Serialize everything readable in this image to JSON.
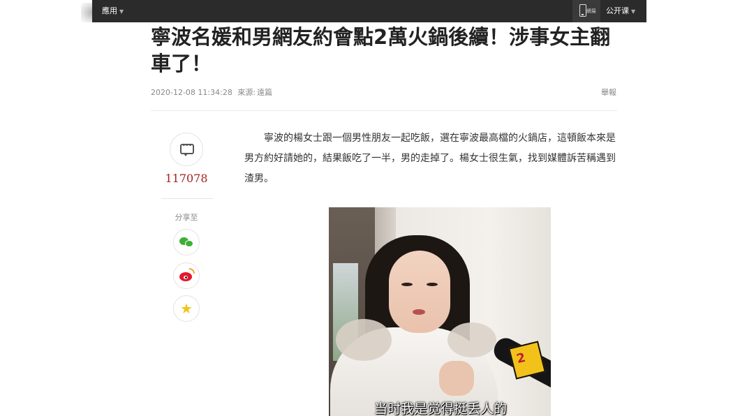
{
  "topbar": {
    "apps_label": "應用",
    "phone_label": "網易",
    "open_course_label": "公开课"
  },
  "article": {
    "title": "寧波名媛和男網友約會點2萬火鍋後續！涉事女主翻車了！",
    "datetime": "2020-12-08 11:34:28",
    "source_prefix": "來源:",
    "source": "遠篇",
    "report_label": "舉報",
    "paragraph": "寧波的楊女士跟一個男性朋友一起吃飯，選在寧波最高檔的火鍋店，這頓飯本來是男方約好請她的，結果飯吃了一半，男的走掉了。楊女士很生氣，找到媒體訴苦稱遇到渣男。",
    "image": {
      "subtitle": "当时我是觉得挺丢人的"
    }
  },
  "sidebar": {
    "comment_icon": "comment-icon",
    "comment_count": "117078",
    "share_label": "分享至",
    "share_icons": [
      "wechat-icon",
      "weibo-icon",
      "favorite-icon"
    ]
  },
  "colors": {
    "topbar_bg": "#2b2b2b",
    "count_red": "#a52020",
    "wechat_green": "#3cb034",
    "weibo_red": "#e6162d",
    "star_yellow": "#f0c419"
  }
}
